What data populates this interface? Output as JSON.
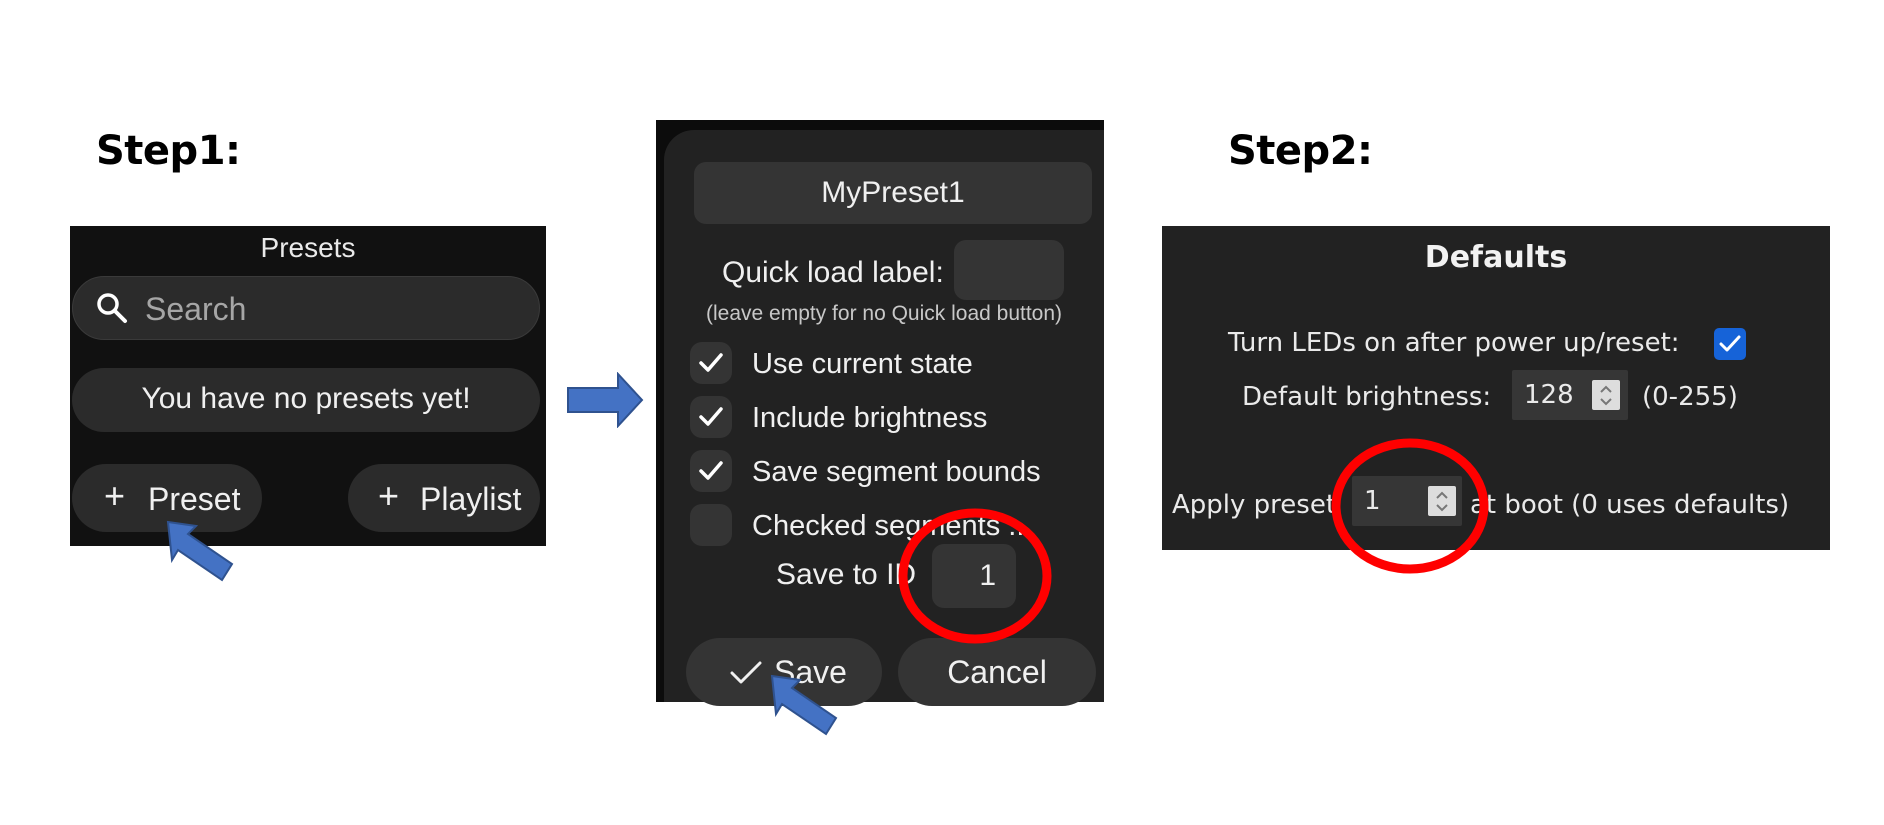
{
  "steps": {
    "step1": "Step1:",
    "step2": "Step2:"
  },
  "presets_panel": {
    "title": "Presets",
    "search_placeholder": "Search",
    "empty_message": "You have no presets yet!",
    "add_preset_label": "Preset",
    "add_playlist_label": "Playlist"
  },
  "save_dialog": {
    "name_value": "MyPreset1",
    "quick_load_label": "Quick load label:",
    "quick_load_value": "",
    "quick_load_hint": "(leave empty for no Quick load button)",
    "options": [
      {
        "label": "Use current state",
        "checked": true
      },
      {
        "label": "Include brightness",
        "checked": true
      },
      {
        "label": "Save segment bounds",
        "checked": true
      },
      {
        "label": "Checked segments ...",
        "checked": false
      }
    ],
    "save_to_id_label": "Save to ID",
    "save_to_id_value": "1",
    "save_label": "Save",
    "cancel_label": "Cancel"
  },
  "defaults_panel": {
    "title": "Defaults",
    "turn_on_label": "Turn LEDs on after power up/reset:",
    "turn_on_checked": true,
    "brightness_label": "Default brightness:",
    "brightness_value": "128",
    "brightness_range": "(0-255)",
    "apply_preset_label": "Apply preset",
    "apply_preset_value": "1",
    "apply_preset_suffix": "at boot (0 uses defaults)"
  },
  "colors": {
    "annotation_arrow": "#4472c4",
    "annotation_circle": "#ff0000",
    "checkbox_accent": "#1663d8"
  }
}
